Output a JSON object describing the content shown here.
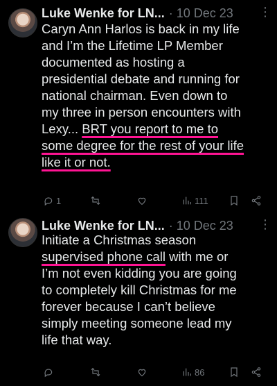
{
  "tweets": [
    {
      "author": "Luke Wenke for LN...",
      "date": "· 10 Dec 23",
      "more": "⋮",
      "lines": [
        {
          "a": "Caryn Ann Harlos is back in my life",
          "hl": ""
        },
        {
          "a": "and I’m the Lifetime LP Member",
          "hl": ""
        },
        {
          "a": "documented as hosting a",
          "hl": ""
        },
        {
          "a": "presidential debate and running for",
          "hl": ""
        },
        {
          "a": "national chairman.  Even down to",
          "hl": ""
        },
        {
          "a": "my three in person encounters with",
          "hl": ""
        },
        {
          "a": "Lexy... ",
          "hl": "BRT you report to me to"
        },
        {
          "a": "",
          "hl": "some degree for the rest of your life"
        },
        {
          "a": "",
          "hl": "like it or not."
        }
      ],
      "replies": "1",
      "retweets": "",
      "likes": "",
      "views": "111"
    },
    {
      "author": "Luke Wenke for LN...",
      "date": "· 10 Dec 23",
      "more": "⋮",
      "lines": [
        {
          "a": "Initiate a Christmas season",
          "hl": ""
        },
        {
          "a": "",
          "hl": "supervised phone call",
          "b": " with me or"
        },
        {
          "a": "I’m not even kidding you are going",
          "hl": ""
        },
        {
          "a": "to completely kill Christmas for me",
          "hl": ""
        },
        {
          "a": "forever because I can’t believe",
          "hl": ""
        },
        {
          "a": "simply meeting someone lead my",
          "hl": ""
        },
        {
          "a": "life that way.",
          "hl": ""
        }
      ],
      "replies": "",
      "retweets": "",
      "likes": "",
      "views": "86"
    }
  ],
  "colors": {
    "background": "#000000",
    "text": "#e7e9ea",
    "muted": "#71767b",
    "highlight": "#ff1493"
  },
  "icons": [
    "reply-icon",
    "retweet-icon",
    "like-icon",
    "views-icon",
    "bookmark-icon",
    "share-icon"
  ]
}
